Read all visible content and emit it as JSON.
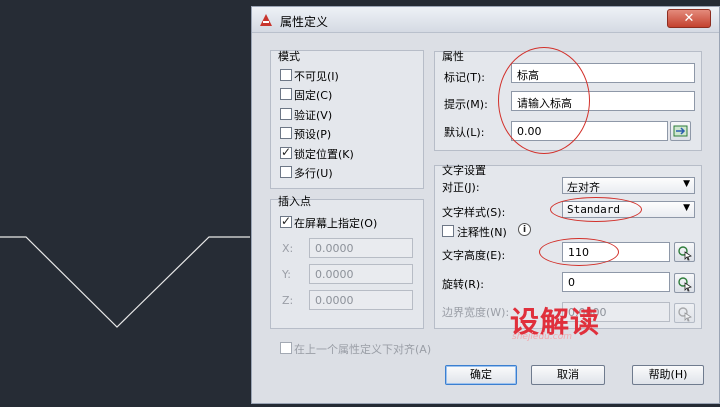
{
  "dialog": {
    "title": "属性定义",
    "close_glyph": "✕"
  },
  "mode": {
    "legend": "模式",
    "items": [
      {
        "label": "不可见(I)",
        "checked": false
      },
      {
        "label": "固定(C)",
        "checked": false
      },
      {
        "label": "验证(V)",
        "checked": false
      },
      {
        "label": "预设(P)",
        "checked": false
      },
      {
        "label": "锁定位置(K)",
        "checked": true
      },
      {
        "label": "多行(U)",
        "checked": false
      }
    ]
  },
  "insertion": {
    "legend": "插入点",
    "specify_label": "在屏幕上指定(O)",
    "specify_checked": true,
    "x_label": "X:",
    "x_value": "0.0000",
    "y_label": "Y:",
    "y_value": "0.0000",
    "z_label": "Z:",
    "z_value": "0.0000"
  },
  "attribute": {
    "legend": "属性",
    "tag_label": "标记(T):",
    "tag_value": "标高",
    "prompt_label": "提示(M):",
    "prompt_value": "请输入标高",
    "default_label": "默认(L):",
    "default_value": "0.00"
  },
  "text": {
    "legend": "文字设置",
    "justify_label": "对正(J):",
    "justify_value": "左对齐",
    "style_label": "文字样式(S):",
    "style_value": "Standard",
    "annotative_label": "注释性(N)",
    "annotative_checked": false,
    "info_glyph": "i",
    "height_label": "文字高度(E):",
    "height_value": "110",
    "rotation_label": "旋转(R):",
    "rotation_value": "0",
    "boundary_label": "边界宽度(W):",
    "boundary_value": "0.0000"
  },
  "align_below": {
    "label": "在上一个属性定义下对齐(A)",
    "checked": false
  },
  "buttons": {
    "ok": "确定",
    "cancel": "取消",
    "help": "帮助(H)"
  },
  "watermark": {
    "main": "设解读",
    "sub": "shejiedu.com"
  },
  "colors": {
    "annotation": "#d2302a",
    "watermark_red": "#e0303c",
    "watermark_gray": "#555555"
  }
}
